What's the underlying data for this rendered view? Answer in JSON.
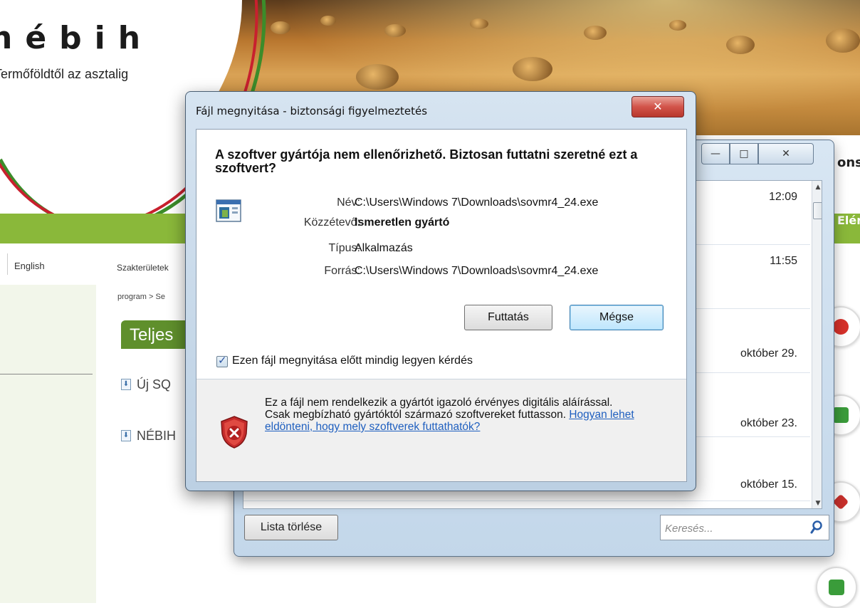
{
  "site": {
    "logo_text": "nébih",
    "slogan": "Termőföldtől az asztalig",
    "right_header_fragment": "ons",
    "right_green_fragment": "Elér",
    "language_link": "English",
    "nav_text": "Szakterületek",
    "breadcrumb": "program > Se",
    "section_tab": "Teljes",
    "doc_links": [
      "Új SQ",
      "NÉBIH"
    ]
  },
  "downloads": {
    "items": [
      {
        "time": "12:09"
      },
      {
        "time": "11:55"
      },
      {
        "time": "október 29."
      },
      {
        "time": "október 23."
      },
      {
        "time": "október 15."
      }
    ],
    "clear_label": "Lista törlése",
    "search_placeholder": "Keresés...",
    "controls": {
      "minimize": "—",
      "maximize": "□",
      "close": "✕"
    }
  },
  "dialog": {
    "title": "Fájl megnyitása - biztonsági figyelmeztetés",
    "close": "✕",
    "question": "A szoftver gyártója nem ellenőrizhető. Biztosan futtatni szeretné ezt a szoftvert?",
    "fields": {
      "name_label": "Név:",
      "name_value": "C:\\Users\\Windows 7\\Downloads\\sovmr4_24.exe",
      "publisher_label": "Közzétevő:",
      "publisher_value": "Ismeretlen gyártó",
      "type_label": "Típus:",
      "type_value": "Alkalmazás",
      "source_label": "Forrás:",
      "source_value": "C:\\Users\\Windows 7\\Downloads\\sovmr4_24.exe"
    },
    "run_label": "Futtatás",
    "cancel_label": "Mégse",
    "always_ask_label": "Ezen fájl megnyitása előtt mindig legyen kérdés",
    "always_ask_checked": true,
    "warning_text": "Ez a fájl nem rendelkezik a gyártót igazoló érvényes digitális aláírással. Csak megbízható gyártóktól származó szoftvereket futtasson.",
    "help_link": "Hogyan lehet eldönteni, hogy mely szoftverek futtathatók?"
  },
  "colors": {
    "site_green": "#8ab83a",
    "dialog_frame": "#bcd0e3",
    "link": "#1f5fbf",
    "close_red": "#d2544a"
  }
}
